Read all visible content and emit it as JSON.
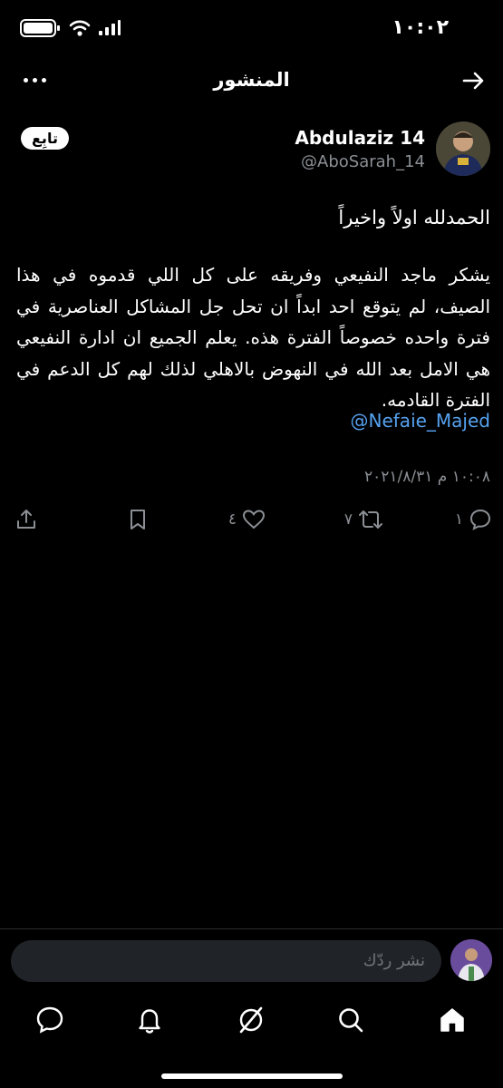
{
  "status_bar": {
    "time": "١٠:٠٢"
  },
  "header": {
    "title": "المنشور"
  },
  "user": {
    "name": "Abdulaziz 14",
    "handle": "@AboSarah_14",
    "follow_label": "تابِع"
  },
  "tweet": {
    "line1": "الحمدلله اولاً واخيراً",
    "paragraph": "يشكر ماجد النفيعي وفريقه على كل اللي قدموه في هذا الصيف، لم يتوقع احد ابداً ان تحل جل المشاكل العناصرية في فترة واحده خصوصاً الفترة هذه. يعلم الجميع ان ادارة النفيعي هي الامل بعد الله في النهوض بالاهلي لذلك لهم كل الدعم في الفترة القادمه.",
    "mention": "@Nefaie_Majed",
    "date": "١٠:٠٨ م ٢٠٢١/٨/٣١"
  },
  "actions": {
    "replies": "١",
    "retweets": "٧",
    "likes": "٤"
  },
  "reply_bar": {
    "placeholder": "نشر ردّك"
  },
  "colors": {
    "accent": "#56a2f0",
    "muted": "#8b8f94",
    "background": "#000000"
  }
}
